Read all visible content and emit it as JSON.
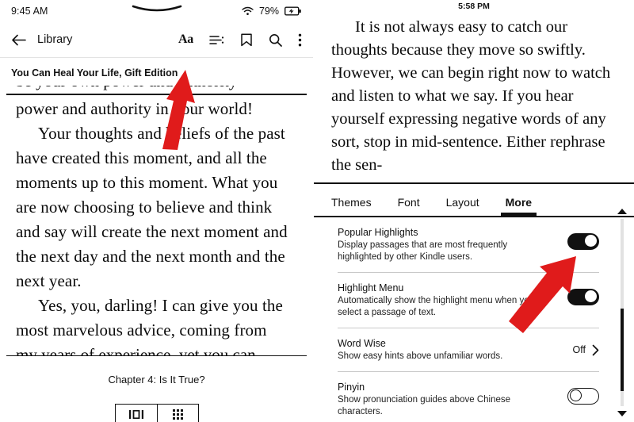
{
  "left_screen": {
    "status_bar": {
      "time": "9:45 AM",
      "battery_percent": "79%",
      "wifi_icon": "wifi-icon",
      "battery_icon": "battery-charging-icon",
      "notch_icon": "camera-notch"
    },
    "toolbar": {
      "back_icon": "arrow-left-icon",
      "back_label": "Library",
      "font_icon_label": "Aa",
      "toc_icon": "table-of-contents-icon",
      "bookmark_icon": "bookmark-icon",
      "search_icon": "search-icon",
      "more_icon": "overflow-menu-icon"
    },
    "book": {
      "title": "You Can Heal Your Life, Gift Edition",
      "clipped_top_line": "be your own power and authority",
      "paragraphs": [
        "power and authority in your world!",
        "Your thoughts and beliefs of the past have created this moment, and all the moments up to this moment. What you are now choosing to believe and think and say will create the next moment and the next day and the next month and the next year.",
        "Yes, you, darling! I can give you the most marvelous advice, coming from"
      ],
      "clipped_bottom_line": "my years of experience, yet you can",
      "chapter_label": "Chapter 4: Is It True?"
    },
    "view_toggle": {
      "page_view_icon": "page-view-icon",
      "grid_view_icon": "grid-view-icon"
    }
  },
  "right_screen": {
    "status_bar": {
      "time": "5:58 PM"
    },
    "book": {
      "paragraph": "It is not always easy to catch our thoughts because they move so swiftly. However, we can begin right now to watch and listen to what we say. If you hear yourself expressing negative words of any sort, stop in mid-sentence. Either rephrase the sen-"
    },
    "tabs": [
      {
        "label": "Themes",
        "active": false
      },
      {
        "label": "Font",
        "active": false
      },
      {
        "label": "Layout",
        "active": false
      },
      {
        "label": "More",
        "active": true
      }
    ],
    "settings": [
      {
        "title": "Popular Highlights",
        "description": "Display passages that are most frequently highlighted by other Kindle users.",
        "control": "toggle",
        "state": "on"
      },
      {
        "title": "Highlight Menu",
        "description": "Automatically show the highlight menu when you select a passage of text.",
        "control": "toggle",
        "state": "on"
      },
      {
        "title": "Word Wise",
        "description": "Show easy hints above unfamiliar words.",
        "control": "value",
        "value": "Off",
        "chevron_icon": "chevron-right-icon"
      },
      {
        "title": "Pinyin",
        "description": "Show pronunciation guides above Chinese characters.",
        "control": "toggle",
        "state": "off"
      }
    ],
    "scrollbar": {
      "up_icon": "scroll-up-arrow-icon",
      "down_icon": "scroll-down-arrow-icon"
    }
  },
  "annotations": {
    "arrow_color": "#E01B1B",
    "arrows": [
      {
        "name": "arrow-pointing-to-font-button",
        "target": "Aa font settings button"
      },
      {
        "name": "arrow-pointing-to-popular-highlights-toggle",
        "target": "Popular Highlights toggle"
      }
    ]
  }
}
